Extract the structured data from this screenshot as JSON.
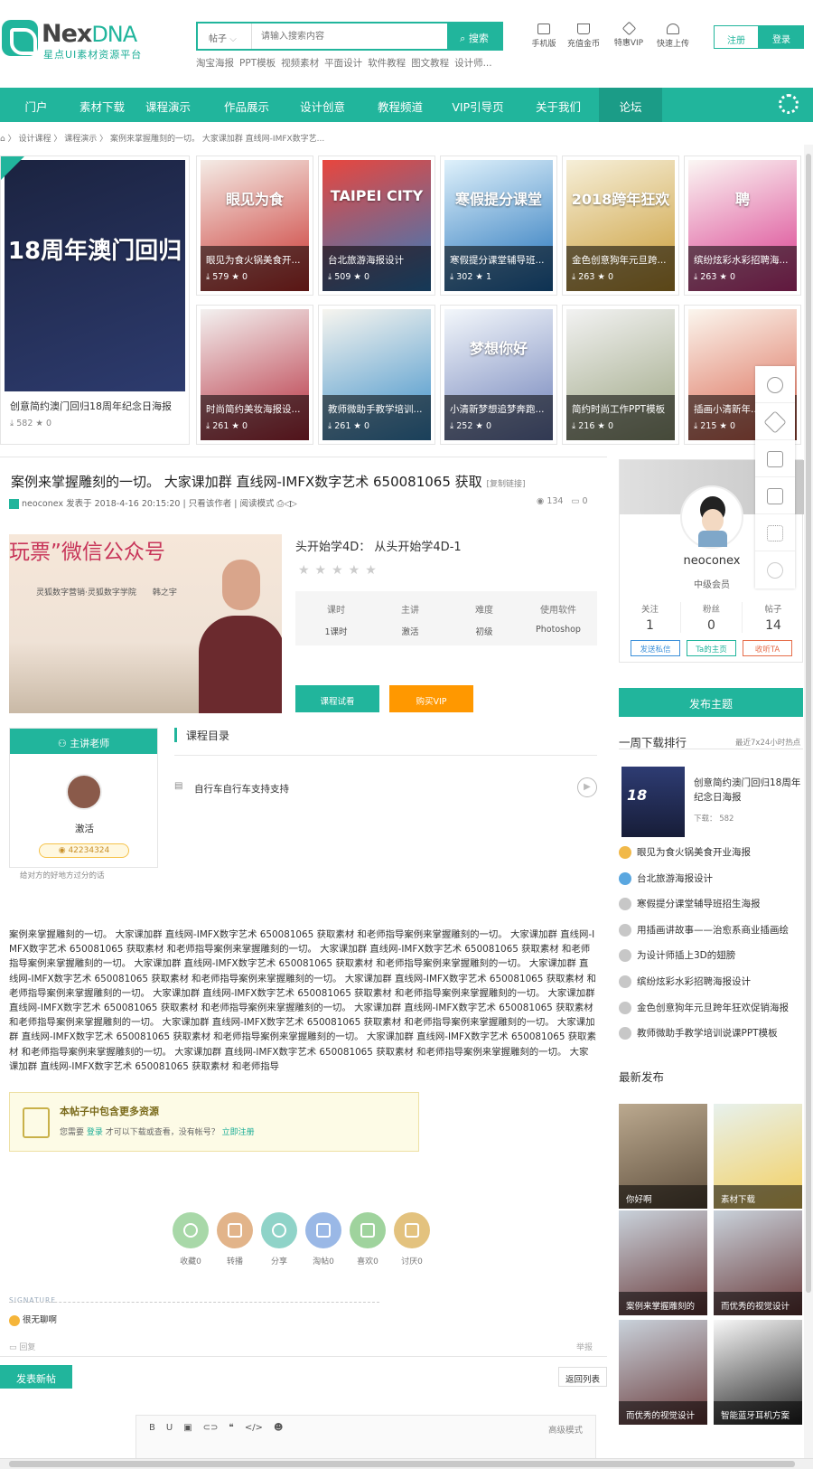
{
  "header": {
    "brand_main": "Nex",
    "brand_suffix": "DNA",
    "tagline": "星点UI素材资源平台",
    "search": {
      "category": "帖子",
      "placeholder": "请输入搜索内容",
      "button": "搜索"
    },
    "hot_tags": [
      "淘宝海报",
      "PPT模板",
      "视频素材",
      "平面设计",
      "软件教程",
      "图文教程",
      "设计师..."
    ],
    "tools": [
      "手机版",
      "充值金币",
      "特惠VIP",
      "快速上传"
    ],
    "register": "注册",
    "login": "登录"
  },
  "nav": {
    "items": [
      "门户",
      "素材下载",
      "课程演示",
      "作品展示",
      "设计创意",
      "教程频道",
      "VIP引导页",
      "关于我们",
      "论坛"
    ],
    "active": 8
  },
  "breadcrumb": [
    "设计课程",
    "课程演示",
    "案例来掌握雕刻的一切。 大家课加群 直线网-IMFX数字艺..."
  ],
  "gallery": [
    {
      "title": "创意简约澳门回归18周年纪念日海报",
      "downloads": "582",
      "likes": "0",
      "poster": "18周年澳门回归",
      "colors": [
        "#1b2340",
        "#2d3b6e"
      ]
    },
    {
      "title": "眼见为食火锅美食开...",
      "downloads": "579",
      "likes": "0",
      "poster": "眼见为食",
      "colors": [
        "#f4ece6",
        "#c9302c"
      ]
    },
    {
      "title": "台北旅游海报设计",
      "downloads": "509",
      "likes": "0",
      "poster": "TAIPEI CITY",
      "colors": [
        "#e8463e",
        "#2f7ec2"
      ]
    },
    {
      "title": "寒假提分课堂辅导班...",
      "downloads": "302",
      "likes": "1",
      "poster": "寒假提分课堂",
      "colors": [
        "#dff1fb",
        "#1e6fb8"
      ]
    },
    {
      "title": "金色创意狗年元旦跨...",
      "downloads": "263",
      "likes": "0",
      "poster": "2018跨年狂欢",
      "colors": [
        "#f6efd9",
        "#c99a32"
      ]
    },
    {
      "title": "缤纷炫彩水彩招聘海...",
      "downloads": "263",
      "likes": "0",
      "poster": "聘",
      "colors": [
        "#fbf7f4",
        "#d8358a"
      ]
    },
    {
      "title": "时尚简约美妆海报设...",
      "downloads": "261",
      "likes": "0",
      "poster": "",
      "colors": [
        "#f3f1f0",
        "#b52a3a"
      ]
    },
    {
      "title": "教师微助手教学培训...",
      "downloads": "261",
      "likes": "0",
      "poster": "",
      "colors": [
        "#f7f5ef",
        "#3a8ec9"
      ]
    },
    {
      "title": "小清新梦想追梦奔跑...",
      "downloads": "252",
      "likes": "0",
      "poster": "梦想你好",
      "colors": [
        "#f3f7fb",
        "#6d7fb8"
      ]
    },
    {
      "title": "简约时尚工作PPT模板",
      "downloads": "216",
      "likes": "0",
      "poster": "",
      "colors": [
        "#f2f2f2",
        "#9aa37f"
      ]
    },
    {
      "title": "插画小清新年...",
      "downloads": "215",
      "likes": "0",
      "poster": "",
      "colors": [
        "#fbf6ee",
        "#d9614b"
      ]
    }
  ],
  "post": {
    "title": "案例来掌握雕刻的一切。 大家课加群 直线网-IMFX数字艺术 650081065 获取",
    "copy_link": "[复制链接]",
    "author": "neoconex",
    "posted": "发表于 2018-4-16 20:15:20",
    "only_author": "只看该作者",
    "read_mode": "阅读模式",
    "views": "134",
    "replies": "0"
  },
  "course": {
    "title": "头开始学4D： 从头开始学4D-1",
    "video_banner": "玩票”微信公众号",
    "video_sub": "灵狐数字营销·灵狐数字学院　　韩之宇",
    "info": [
      {
        "label": "课时",
        "value": "1课时"
      },
      {
        "label": "主讲",
        "value": "激活"
      },
      {
        "label": "难度",
        "value": "初级"
      },
      {
        "label": "使用软件",
        "value": "Photoshop"
      }
    ],
    "try_button": "课程试看",
    "vip_button": "购买VIP",
    "teacher_header": "主讲老师",
    "teacher_name": "激活",
    "teacher_coins": "42234324",
    "teacher_bio": "给对方的好地方过分的话",
    "catalog_header": "课程目录",
    "lessons": [
      "自行车自行车支持支持"
    ]
  },
  "body": "案例来掌握雕刻的一切。 大家课加群 直线网-IMFX数字艺术 650081065 获取素材 和老师指导案例来掌握雕刻的一切。 大家课加群 直线网-IMFX数字艺术 650081065 获取素材 和老师指导案例来掌握雕刻的一切。 大家课加群 直线网-IMFX数字艺术 650081065 获取素材 和老师指导案例来掌握雕刻的一切。 大家课加群 直线网-IMFX数字艺术 650081065 获取素材 和老师指导案例来掌握雕刻的一切。 大家课加群 直线网-IMFX数字艺术 650081065 获取素材 和老师指导案例来掌握雕刻的一切。 大家课加群 直线网-IMFX数字艺术 650081065 获取素材 和老师指导案例来掌握雕刻的一切。 大家课加群 直线网-IMFX数字艺术 650081065 获取素材 和老师指导案例来掌握雕刻的一切。 大家课加群 直线网-IMFX数字艺术 650081065 获取素材 和老师指导案例来掌握雕刻的一切。 大家课加群 直线网-IMFX数字艺术 650081065 获取素材 和老师指导案例来掌握雕刻的一切。 大家课加群 直线网-IMFX数字艺术 650081065 获取素材 和老师指导案例来掌握雕刻的一切。 大家课加群 直线网-IMFX数字艺术 650081065 获取素材 和老师指导案例来掌握雕刻的一切。 大家课加群 直线网-IMFX数字艺术 650081065 获取素材 和老师指导案例来掌握雕刻的一切。 大家课加群 直线网-IMFX数字艺术 650081065 获取素材 和老师指导案例来掌握雕刻的一切。 大家课加群 直线网-IMFX数字艺术 650081065 获取素材 和老师指导",
  "resource": {
    "title": "本帖子中包含更多资源",
    "pre": "您需要",
    "login": "登录",
    "mid": "才可以下载或查看，没有帐号？",
    "register": "立即注册"
  },
  "actions": [
    {
      "label": "收藏",
      "count": "0",
      "color": "#a8d8a8"
    },
    {
      "label": "转播",
      "count": "",
      "color": "#e2b48a"
    },
    {
      "label": "分享",
      "count": "",
      "color": "#8fd3c8"
    },
    {
      "label": "淘帖",
      "count": "0",
      "color": "#9ab8e6"
    },
    {
      "label": "喜欢",
      "count": "0",
      "color": "#9fd39d"
    },
    {
      "label": "讨厌",
      "count": "0",
      "color": "#e3c27e"
    }
  ],
  "signature": {
    "label": "SIGNATURE",
    "text": "很无聊啊"
  },
  "reply": {
    "label": "回复",
    "report": "举报"
  },
  "footer": {
    "new_post": "发表新帖",
    "back_list": "返回列表",
    "editor_advanced": "高级模式",
    "editor_tools": [
      "B",
      "U",
      "▣",
      "⊂⊃",
      "❝",
      "</>",
      "☻"
    ]
  },
  "author_card": {
    "name": "neoconex",
    "level": "中级会员",
    "stats": [
      {
        "label": "关注",
        "value": "1"
      },
      {
        "label": "粉丝",
        "value": "0"
      },
      {
        "label": "帖子",
        "value": "14"
      }
    ],
    "buttons": [
      "发送私信",
      "Ta的主页",
      "收听TA"
    ],
    "publish": "发布主题"
  },
  "ranking": {
    "title": "一周下载排行",
    "sub": "最近7x24小时热点",
    "top_title": "创意简约澳门回归18周年纪念日海报",
    "top_downloads": "下载： 582",
    "items": [
      "眼见为食火锅美食开业海报",
      "台北旅游海报设计",
      "寒假提分课堂辅导班招生海报",
      "用插画讲故事——治愈系商业插画绘",
      "为设计师插上3D的翅膀",
      "缤纷炫彩水彩招聘海报设计",
      "金色创意狗年元旦跨年狂欢促销海报",
      "教师微助手教学培训说课PPT模板"
    ]
  },
  "latest": {
    "title": "最新发布",
    "tiles": [
      {
        "label": "你好啊",
        "colors": [
          "#bba98f",
          "#5e4e3c"
        ]
      },
      {
        "label": "素材下载",
        "colors": [
          "#e7f1ed",
          "#f4cf5e"
        ]
      },
      {
        "label": "案例来掌握雕刻的",
        "colors": [
          "#c9d2db",
          "#6a3a3a"
        ]
      },
      {
        "label": "而优秀的视觉设计",
        "colors": [
          "#c9d2db",
          "#6a3a3a"
        ]
      },
      {
        "label": "而优秀的视觉设计",
        "colors": [
          "#c9d2db",
          "#6a3a3a"
        ]
      },
      {
        "label": "智能蓝牙耳机方案",
        "colors": [
          "#f8f8f8",
          "#222222"
        ]
      }
    ]
  }
}
